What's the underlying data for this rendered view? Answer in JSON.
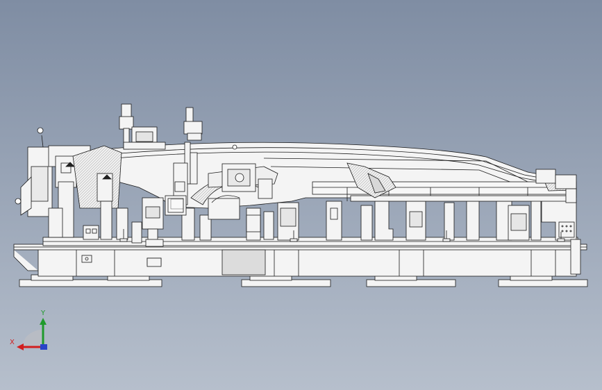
{
  "view": {
    "background_top": "#7f8da3",
    "background_bottom": "#b6bfcc",
    "line_color": "#1a1a1a",
    "part_fill": "#f4f4f4"
  },
  "triad": {
    "x_label": "X",
    "y_label": "Y",
    "x_color": "#d21e1e",
    "y_color": "#1f9a2c",
    "z_color": "#2a44c8"
  }
}
